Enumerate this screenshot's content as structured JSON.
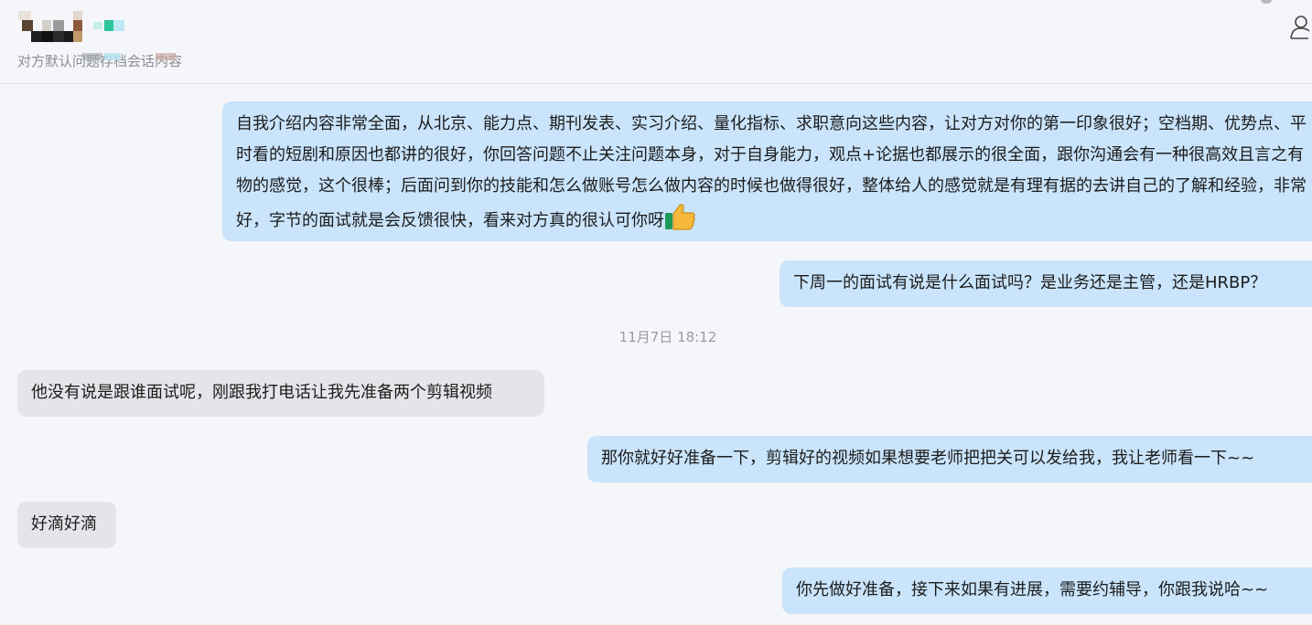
{
  "header": {
    "subtitle": "对方默认问题存档会话内容",
    "icons": {
      "profile": "person-icon"
    }
  },
  "messages": [
    {
      "id": "m1",
      "from": "me",
      "text": "自我介绍内容非常全面，从北京、能力点、期刊发表、实习介绍、量化指标、求职意向这些内容，让对方对你的第一印象很好；空档期、优势点、平时看的短剧和原因也都讲的很好，你回答问题不止关注问题本身，对于自身能力，观点+论据也都展示的很全面，跟你沟通会有一种很高效且言之有物的感觉，这个很棒；后面问到你的技能和怎么做账号怎么做内容的时候也做得很好，整体给人的感觉就是有理有据的去讲自己的了解和经验，非常好，字节的面试就是会反馈很快，看来对方真的很认可你呀",
      "emoji": "thumbs-up-icon"
    },
    {
      "id": "m2",
      "from": "me",
      "text": "下周一的面试有说是什么面试吗？是业务还是主管，还是HRBP？"
    },
    {
      "id": "ts1",
      "type": "timestamp",
      "text": "11月7日 18:12"
    },
    {
      "id": "m3",
      "from": "other",
      "text": "他没有说是跟谁面试呢，刚跟我打电话让我先准备两个剪辑视频"
    },
    {
      "id": "m4",
      "from": "me",
      "text": "那你就好好准备一下，剪辑好的视频如果想要老师把把关可以发给我，我让老师看一下~~"
    },
    {
      "id": "m5",
      "from": "other",
      "text": "好滴好滴"
    },
    {
      "id": "m6",
      "from": "me",
      "text": "你先做好准备，接下来如果有进展，需要约辅导，你跟我说哈~~"
    }
  ],
  "colors": {
    "background": "#f5f6fa",
    "my_bubble": "#c9e4fb",
    "other_bubble": "#e4e5e9",
    "timestamp_text": "#9a9ca1"
  }
}
